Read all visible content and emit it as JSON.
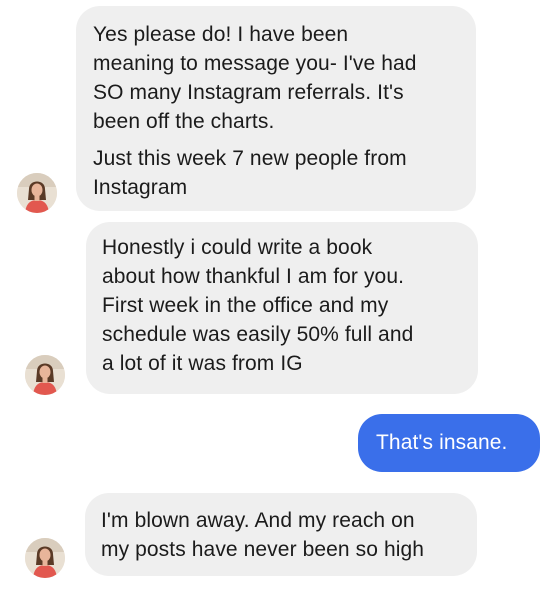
{
  "messages": [
    {
      "direction": "received",
      "paragraphs": [
        [
          "Yes please do! I have been",
          "meaning to message you- I've had",
          "SO many Instagram referrals. It's",
          "been off the charts."
        ],
        [
          "Just this week 7 new people from",
          "Instagram"
        ]
      ]
    },
    {
      "direction": "received",
      "lines": [
        "Honestly i could write a book",
        "about how thankful I am for you.",
        "First week in the office and my",
        "schedule was easily 50% full and",
        "a lot of it was from IG"
      ]
    },
    {
      "direction": "sent",
      "lines": [
        "That's insane."
      ]
    },
    {
      "direction": "received",
      "lines": [
        "I'm blown away. And my reach on",
        "my posts have never been so high"
      ]
    }
  ],
  "colors": {
    "received_bubble": "#efefef",
    "sent_bubble": "#3a6fea",
    "received_text": "#1b1b1b",
    "sent_text": "#ffffff"
  },
  "icons": {
    "avatar": "contact-avatar-icon"
  }
}
